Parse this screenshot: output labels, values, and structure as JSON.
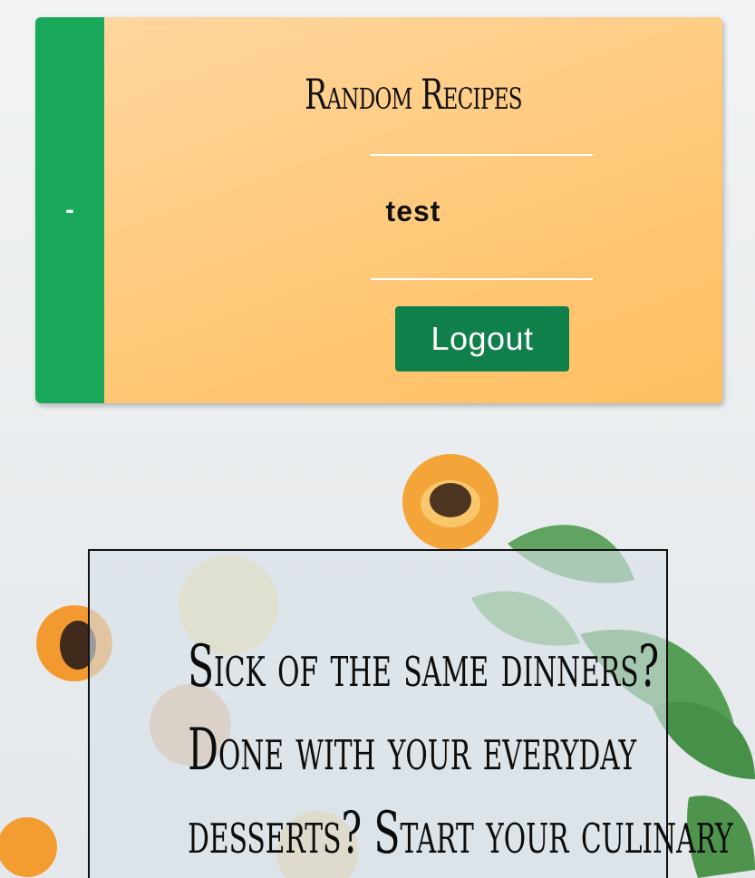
{
  "header": {
    "toggle_label": "-",
    "title": "Random Recipes",
    "username": "test",
    "logout_label": "Logout"
  },
  "hero": {
    "lines": [
      "Sick of the same dinners?",
      "Done with your everyday",
      "desserts? Start your culinary"
    ]
  },
  "colors": {
    "sidebar_green": "#19a85a",
    "button_green": "#10804a",
    "card_orange": "#ffc877"
  },
  "icons": {
    "background": "apricot-leaves-photo"
  }
}
